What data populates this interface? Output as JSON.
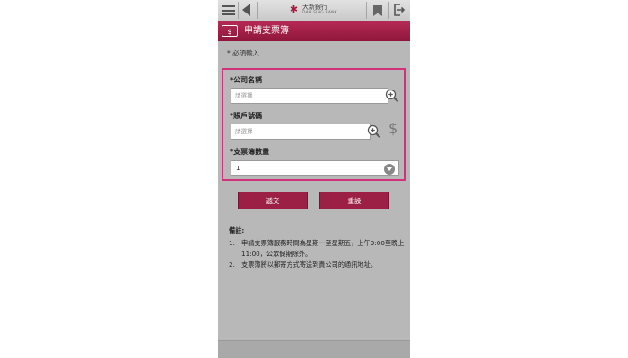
{
  "header": {
    "bank_name_cn": "大新銀行",
    "bank_name_en": "DAH SING BANK"
  },
  "title": {
    "icon_text": "$",
    "text": "申請支票簿"
  },
  "form": {
    "required_note": "* 必須輸入",
    "company_label": "*公司名稱",
    "company_placeholder": "請選擇",
    "account_label": "*賬戶號碼",
    "account_placeholder": "請選擇",
    "quantity_label": "*支票簿數量",
    "quantity_value": "1"
  },
  "buttons": {
    "submit": "遞交",
    "reset": "重設"
  },
  "notes": {
    "title": "備註:",
    "items": [
      {
        "num": "1.",
        "text": "申請支票簿服務時間為星期一至星期五，上午9:00至晚上11:00，公眾假期除外。"
      },
      {
        "num": "2.",
        "text": "支票簿將以郵寄方式寄送到貴公司的通訊地址。"
      }
    ]
  },
  "icons": {
    "menu": "hamburger-menu-icon",
    "back": "back-arrow-icon",
    "bookmark": "bookmark-icon",
    "logout": "logout-icon",
    "search": "zoom-search-icon",
    "dollar": "dollar-icon"
  },
  "colors": {
    "brand": "#9c2045",
    "highlight_border": "#d0327c",
    "background": "#b8b8b8"
  }
}
